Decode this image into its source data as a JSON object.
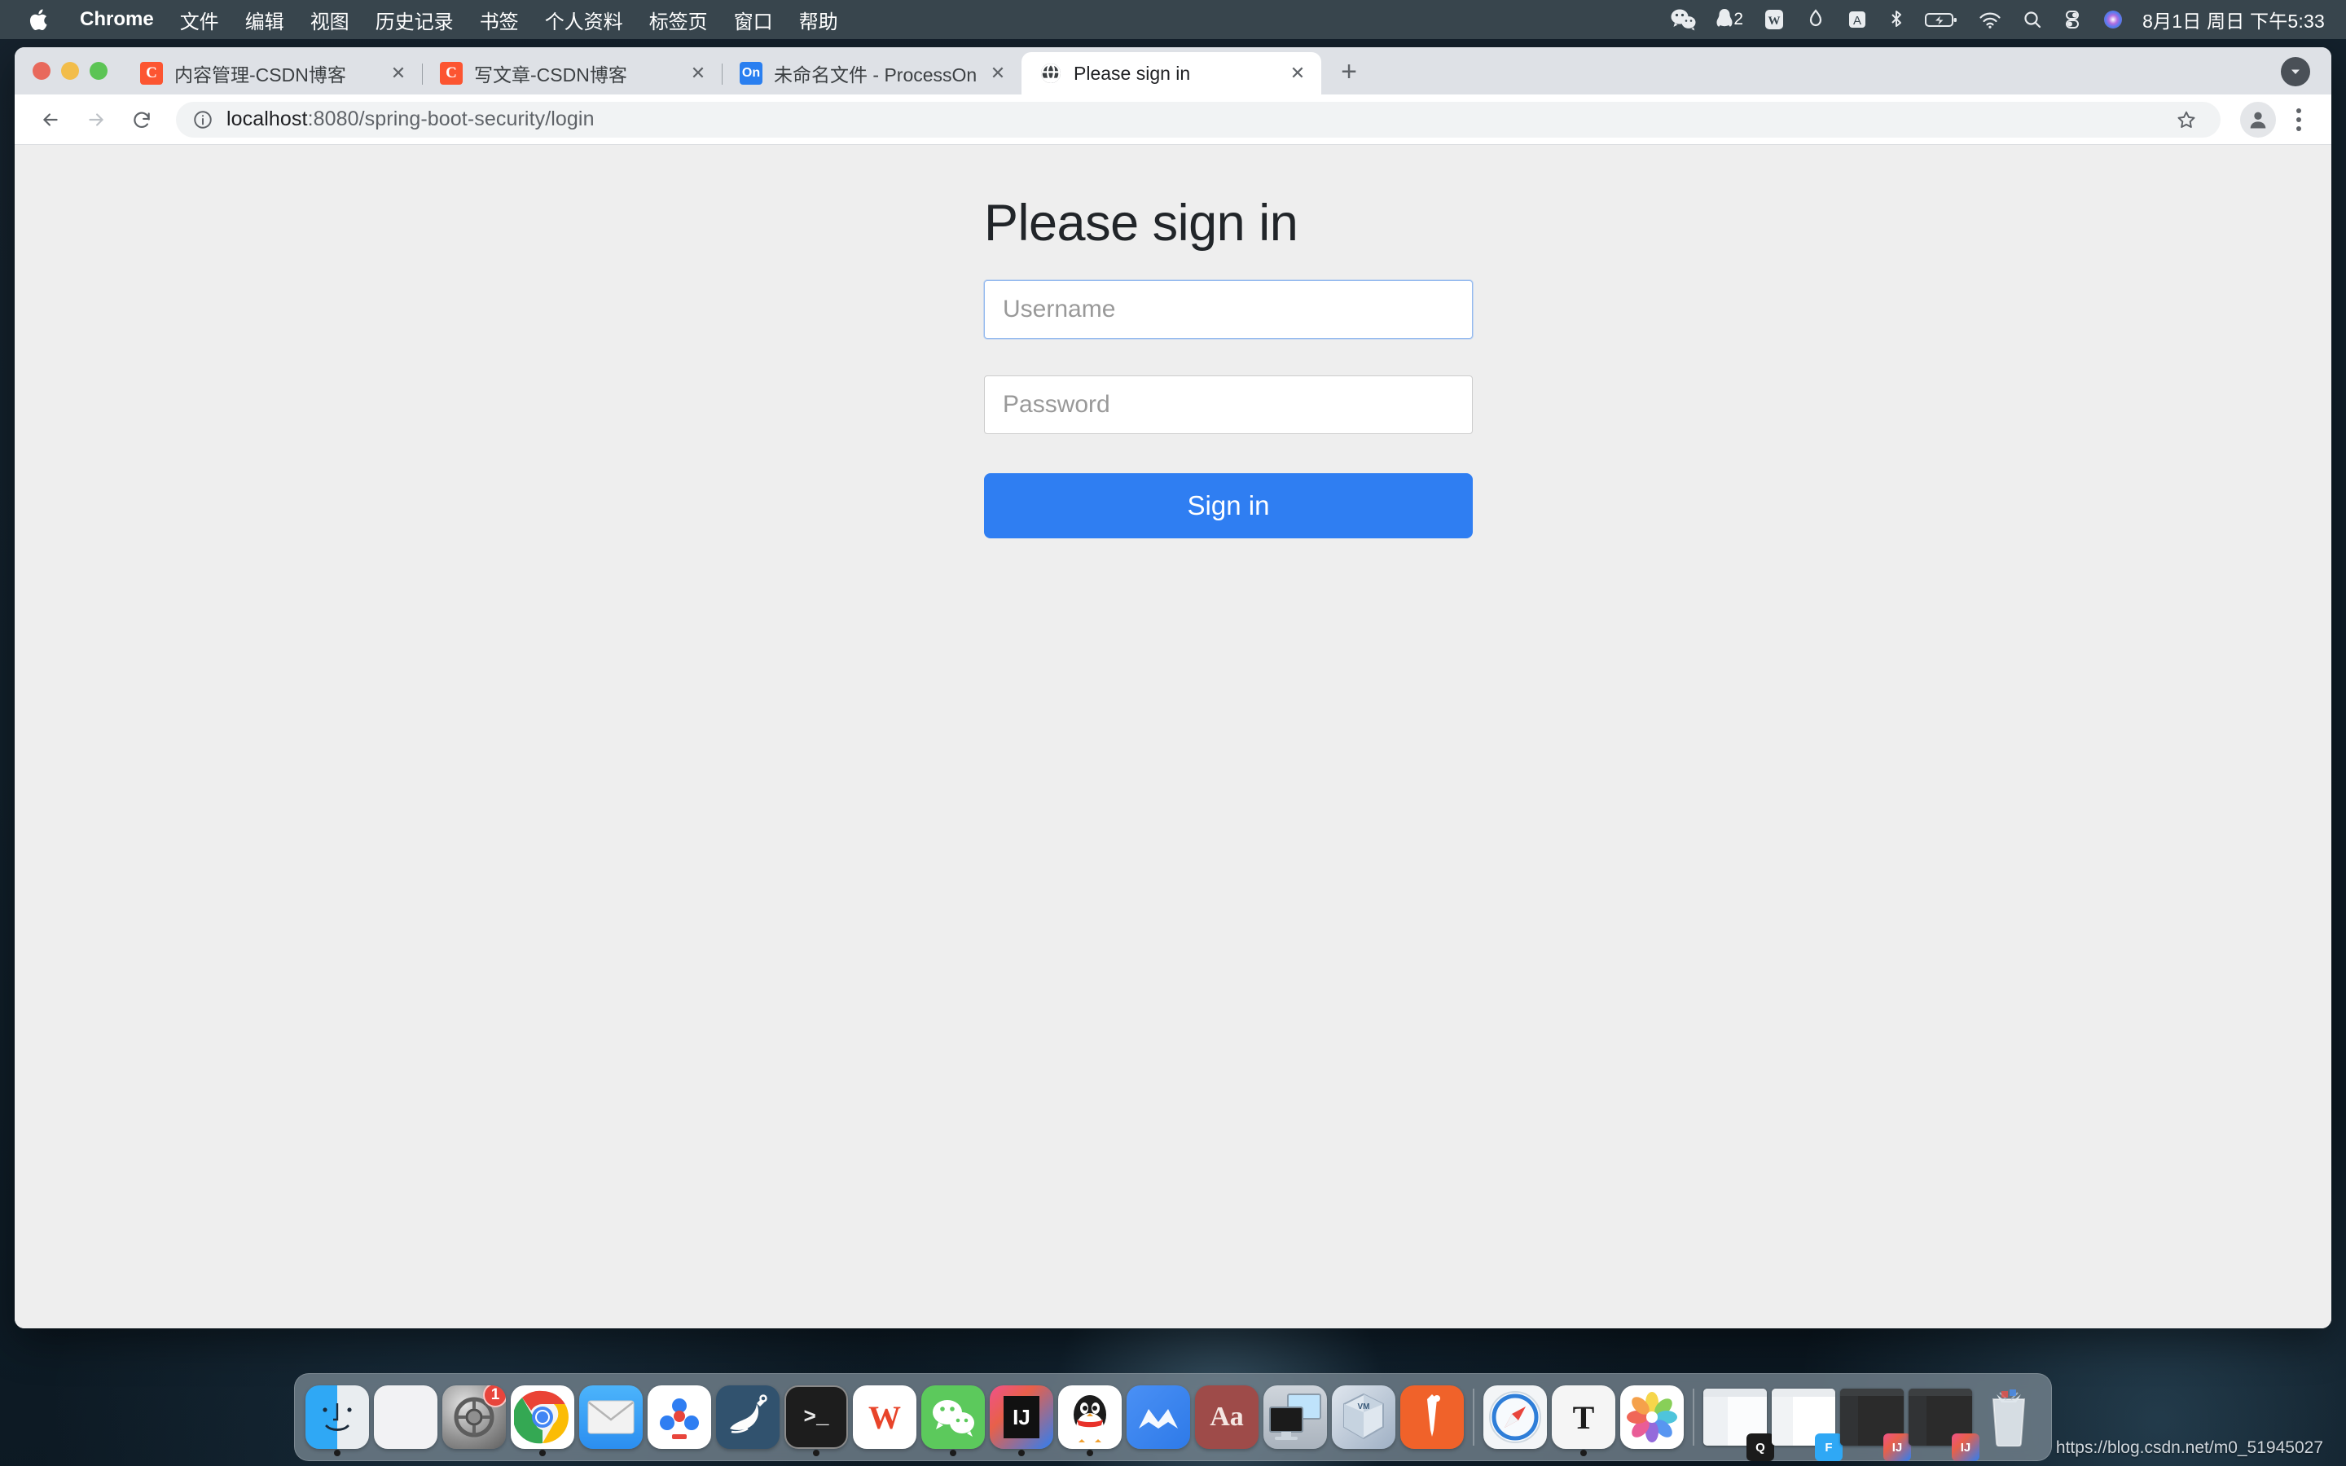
{
  "menubar": {
    "apple_icon": "apple-logo-icon",
    "items": [
      {
        "label": "Chrome",
        "name": "menu-chrome",
        "bold": true
      },
      {
        "label": "文件",
        "name": "menu-file"
      },
      {
        "label": "编辑",
        "name": "menu-edit"
      },
      {
        "label": "视图",
        "name": "menu-view"
      },
      {
        "label": "历史记录",
        "name": "menu-history"
      },
      {
        "label": "书签",
        "name": "menu-bookmarks"
      },
      {
        "label": "个人资料",
        "name": "menu-profiles"
      },
      {
        "label": "标签页",
        "name": "menu-tabs"
      },
      {
        "label": "窗口",
        "name": "menu-window"
      },
      {
        "label": "帮助",
        "name": "menu-help"
      }
    ],
    "status_icons": [
      {
        "name": "wechat-status-icon",
        "glyph": "wechat"
      },
      {
        "name": "qq-status-icon",
        "glyph": "qq",
        "badge": "2"
      },
      {
        "name": "wps-status-icon",
        "glyph": "wps"
      },
      {
        "name": "diamond-status-icon",
        "glyph": "diamond"
      },
      {
        "name": "input-method-status-icon",
        "glyph": "A"
      },
      {
        "name": "bluetooth-status-icon",
        "glyph": "bluetooth"
      },
      {
        "name": "battery-charging-status-icon",
        "glyph": "battery"
      },
      {
        "name": "wifi-status-icon",
        "glyph": "wifi"
      },
      {
        "name": "spotlight-search-icon",
        "glyph": "search"
      },
      {
        "name": "control-center-icon",
        "glyph": "controlcenter"
      },
      {
        "name": "siri-icon",
        "glyph": "siri"
      }
    ],
    "clock": "8月1日 周日 下午5:33"
  },
  "window_controls": {
    "close": "close-window-button",
    "minimize": "minimize-window-button",
    "zoom": "zoom-window-button"
  },
  "tabstrip": {
    "tabs": [
      {
        "title": "内容管理-CSDN博客",
        "favicon": "csdn",
        "favicon_text": "C",
        "active": false
      },
      {
        "title": "写文章-CSDN博客",
        "favicon": "csdn",
        "favicon_text": "C",
        "active": false
      },
      {
        "title": "未命名文件 - ProcessOn",
        "favicon": "processon",
        "favicon_text": "On",
        "active": false
      },
      {
        "title": "Please sign in",
        "favicon": "globe",
        "favicon_text": "",
        "active": true
      }
    ],
    "close_glyph": "✕",
    "new_tab_glyph": "+",
    "tab_search_name": "tab-search-button"
  },
  "toolbar": {
    "back": "back-button",
    "forward": "forward-button",
    "reload": "reload-button",
    "site_info": "site-info-icon",
    "url_host": "localhost",
    "url_path": ":8080/spring-boot-security/login",
    "url_full": "localhost:8080/spring-boot-security/login",
    "bookmark": "bookmark-star-button",
    "profile": "profile-avatar-button",
    "menu": "chrome-menu-button"
  },
  "page": {
    "title": "Please sign in",
    "username": {
      "value": "",
      "placeholder": "Username",
      "focused": true
    },
    "password": {
      "value": "",
      "placeholder": "Password"
    },
    "signin_label": "Sign in",
    "accent_color": "#2f7ef2",
    "background_color": "#eeeeee"
  },
  "status_bar": {
    "text": "https://blog.csdn.net/m0_51945027"
  },
  "dock": {
    "items": [
      {
        "name": "dock-finder",
        "label": "Finder",
        "kind": "finder",
        "running": true
      },
      {
        "name": "dock-launchpad",
        "label": "Launchpad",
        "kind": "launchpad",
        "running": false
      },
      {
        "name": "dock-system-preferences",
        "label": "System Preferences",
        "kind": "prefs",
        "running": false,
        "badge": "1"
      },
      {
        "name": "dock-google-chrome",
        "label": "Google Chrome",
        "kind": "chrome",
        "running": true
      },
      {
        "name": "dock-mail",
        "label": "Mail",
        "kind": "mail",
        "running": false
      },
      {
        "name": "dock-baidu-netdisk",
        "label": "Baidu Netdisk",
        "kind": "netdisk",
        "running": false
      },
      {
        "name": "dock-mysql-workbench",
        "label": "MySQL Workbench",
        "kind": "mysql",
        "running": false
      },
      {
        "name": "dock-terminal",
        "label": "Terminal",
        "kind": "terminal",
        "running": true
      },
      {
        "name": "dock-wps-office",
        "label": "WPS Office",
        "kind": "wps",
        "running": false
      },
      {
        "name": "dock-wechat",
        "label": "WeChat",
        "kind": "wechat",
        "running": true
      },
      {
        "name": "dock-intellij-idea",
        "label": "IntelliJ IDEA",
        "kind": "idea",
        "running": true
      },
      {
        "name": "dock-qq",
        "label": "QQ",
        "kind": "qq",
        "running": true
      },
      {
        "name": "dock-mindmaster",
        "label": "MindMaster",
        "kind": "mm",
        "running": false
      },
      {
        "name": "dock-dictionary",
        "label": "Dictionary",
        "kind": "dict",
        "running": false
      },
      {
        "name": "dock-remote-desktop",
        "label": "Remote Desktop",
        "kind": "rdp",
        "running": false
      },
      {
        "name": "dock-virtualbox",
        "label": "VirtualBox",
        "kind": "vbox",
        "running": false
      },
      {
        "name": "dock-sketch",
        "label": "Sketch",
        "kind": "pen",
        "running": false
      },
      {
        "name": "dock-separator-1",
        "kind": "separator"
      },
      {
        "name": "dock-safari",
        "label": "Safari",
        "kind": "safari",
        "running": false
      },
      {
        "name": "dock-typora",
        "label": "Typora",
        "kind": "typora",
        "running": true
      },
      {
        "name": "dock-photos",
        "label": "Photos",
        "kind": "photos",
        "running": false
      },
      {
        "name": "dock-separator-2",
        "kind": "separator"
      },
      {
        "name": "dock-minimized-qq-window",
        "label": "QQ window",
        "kind": "mini-qq"
      },
      {
        "name": "dock-minimized-finder-window",
        "label": "Finder window",
        "kind": "mini-finder"
      },
      {
        "name": "dock-minimized-idea-window-1",
        "label": "IntelliJ IDEA window",
        "kind": "mini-idea"
      },
      {
        "name": "dock-minimized-idea-window-2",
        "label": "IntelliJ IDEA window",
        "kind": "mini-idea"
      },
      {
        "name": "dock-trash",
        "label": "Trash",
        "kind": "trash"
      }
    ]
  }
}
